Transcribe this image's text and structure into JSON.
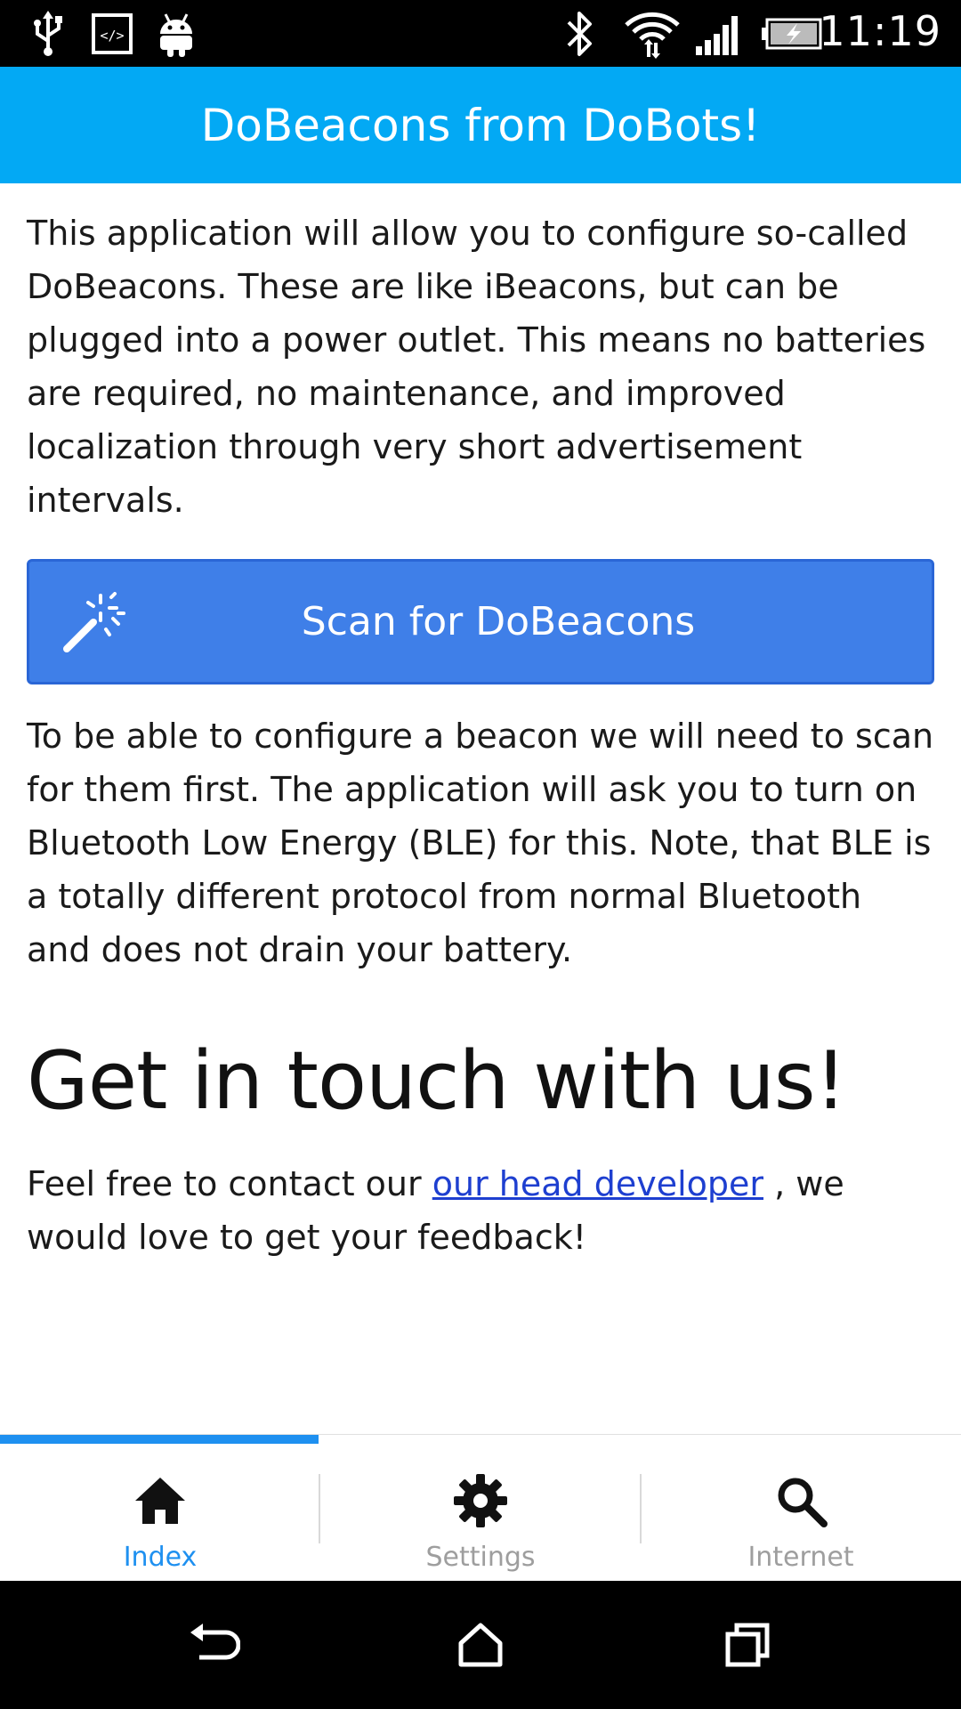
{
  "status_bar": {
    "time": "11:19",
    "icons": [
      "usb-icon",
      "developer-icon",
      "android-icon",
      "bluetooth-icon",
      "wifi-icon",
      "signal-icon",
      "battery-charging-icon"
    ]
  },
  "header": {
    "title": "DoBeacons from DoBots!"
  },
  "main": {
    "intro": "This application will allow you to configure so-called DoBeacons. These are like iBeacons, but can be plugged into a power outlet. This means no batteries are required, no maintenance, and improved localization through very short advertisement intervals.",
    "scan_button": {
      "label": "Scan for DoBeacons",
      "icon": "magic-wand-icon"
    },
    "scan_info": "To be able to configure a beacon we will need to scan for them first. The application will ask you to turn on Bluetooth Low Energy (BLE) for this. Note, that BLE is a totally different protocol from normal Bluetooth and does not drain your battery.",
    "contact_heading": "Get in touch with us!",
    "contact_prefix": "Feel free to contact our ",
    "contact_link": "our head developer",
    "contact_suffix": " , we would love to get your feedback!"
  },
  "tabs": [
    {
      "label": "Index",
      "icon": "home-icon",
      "active": true
    },
    {
      "label": "Settings",
      "icon": "gear-icon",
      "active": false
    },
    {
      "label": "Internet",
      "icon": "search-icon",
      "active": false
    }
  ],
  "colors": {
    "header": "#03A9F4",
    "button": "#3F7FE8",
    "tab_active": "#1E90F0",
    "tab_inactive": "#9E9E9E",
    "link": "#1E3FD0"
  },
  "nav": [
    "back-icon",
    "home-nav-icon",
    "recents-icon"
  ]
}
